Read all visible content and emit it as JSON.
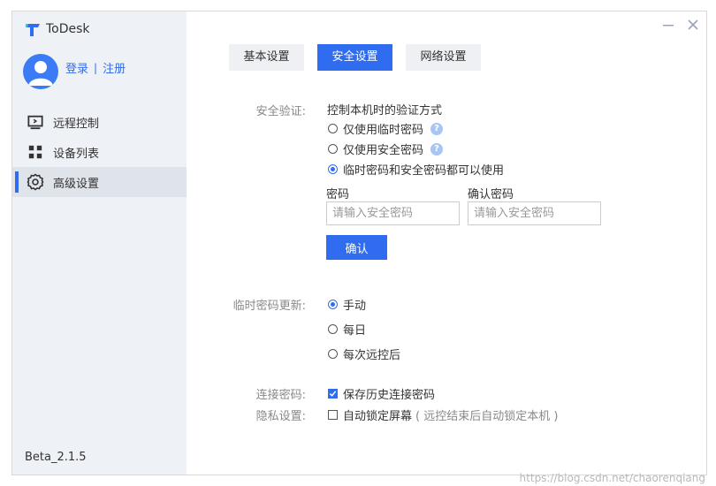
{
  "app": {
    "title": "ToDesk",
    "version": "Beta_2.1.5"
  },
  "auth": {
    "login": "登录",
    "separator": "|",
    "register": "注册"
  },
  "sidebar": {
    "items": [
      {
        "label": "远程控制",
        "icon": "remote-control-icon",
        "active": false
      },
      {
        "label": "设备列表",
        "icon": "device-grid-icon",
        "active": false
      },
      {
        "label": "高级设置",
        "icon": "gear-icon",
        "active": true
      }
    ]
  },
  "tabs": [
    {
      "label": "基本设置",
      "active": false
    },
    {
      "label": "安全设置",
      "active": true
    },
    {
      "label": "网络设置",
      "active": false
    }
  ],
  "security": {
    "label": "安全验证:",
    "description": "控制本机时的验证方式",
    "options": [
      {
        "label": "仅使用临时密码",
        "checked": false,
        "help": "?"
      },
      {
        "label": "仅使用安全密码",
        "checked": false,
        "help": "?"
      },
      {
        "label": "临时密码和安全密码都可以使用",
        "checked": true
      }
    ],
    "password_label": "密码",
    "password_placeholder": "请输入安全密码",
    "password_value": "",
    "confirm_label": "确认密码",
    "confirm_placeholder": "请输入安全密码",
    "confirm_value": "",
    "confirm_button": "确认"
  },
  "temp_update": {
    "label": "临时密码更新:",
    "options": [
      {
        "label": "手动",
        "checked": true
      },
      {
        "label": "每日",
        "checked": false
      },
      {
        "label": "每次远控后",
        "checked": false
      }
    ]
  },
  "connection": {
    "label": "连接密码:",
    "option": "保存历史连接密码",
    "checked": true
  },
  "privacy": {
    "label": "隐私设置:",
    "option": "自动锁定屏幕",
    "hint": "( 远控结束后自动锁定本机 )",
    "checked": false
  },
  "watermark": "https://blog.csdn.net/chaorenqiang",
  "colors": {
    "accent": "#2f6cf0",
    "sidebar_bg": "#eef1f6"
  }
}
